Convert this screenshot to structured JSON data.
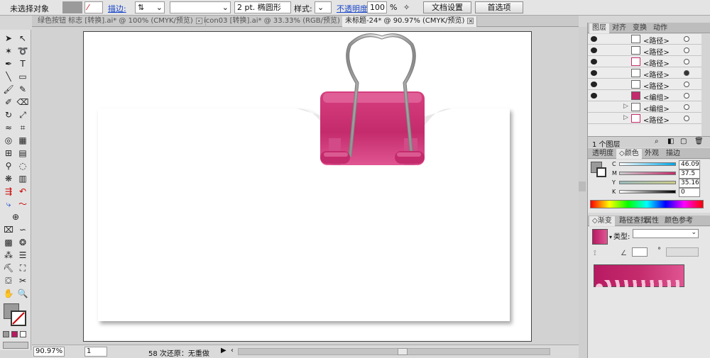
{
  "control_bar": {
    "selection": "未选择对象",
    "stroke_label": "描边:",
    "stroke_weight": "2 pt. 椭圆形",
    "style_label": "样式:",
    "opacity_label": "不透明度:",
    "opacity_value": "100",
    "opacity_unit": "%",
    "doc_setup": "文档设置",
    "prefs": "首选项"
  },
  "tabs": [
    {
      "label": "绿色按钮 标志 [转换].ai* @ 100% (CMYK/预览)"
    },
    {
      "label": "icon03 [转换].ai* @ 33.33% (RGB/预览)"
    },
    {
      "label": "未标题-24* @ 90.97% (CMYK/预览)"
    }
  ],
  "status": {
    "zoom": "90.97%",
    "page": "1",
    "undo": "58 次还原：无重做"
  },
  "layers": {
    "tabs": [
      "图层",
      "对齐",
      "变换",
      "动作"
    ],
    "rows": [
      {
        "name": "<路径>"
      },
      {
        "name": "<路径>"
      },
      {
        "name": "<路径>"
      },
      {
        "name": "<路径>"
      },
      {
        "name": "<路径>"
      },
      {
        "name": "<编组>"
      },
      {
        "name": "<编组>"
      },
      {
        "name": "<路径>"
      }
    ],
    "footer": "1 个图层"
  },
  "color": {
    "tabs": [
      "透明度",
      "颜色",
      "外观",
      "描边"
    ],
    "channels": [
      {
        "label": "C",
        "value": "46.09"
      },
      {
        "label": "M",
        "value": "37.5"
      },
      {
        "label": "Y",
        "value": "35.16"
      },
      {
        "label": "K",
        "value": "0"
      }
    ]
  },
  "gradient": {
    "tabs": [
      "渐变",
      "路径查找",
      "属性",
      "颜色参考"
    ],
    "type_label": "类型:",
    "angle_unit": "°"
  },
  "colors": {
    "accent": "#d63f7f",
    "gradient_dark": "#b81a62",
    "gradient_light": "#e05592"
  }
}
